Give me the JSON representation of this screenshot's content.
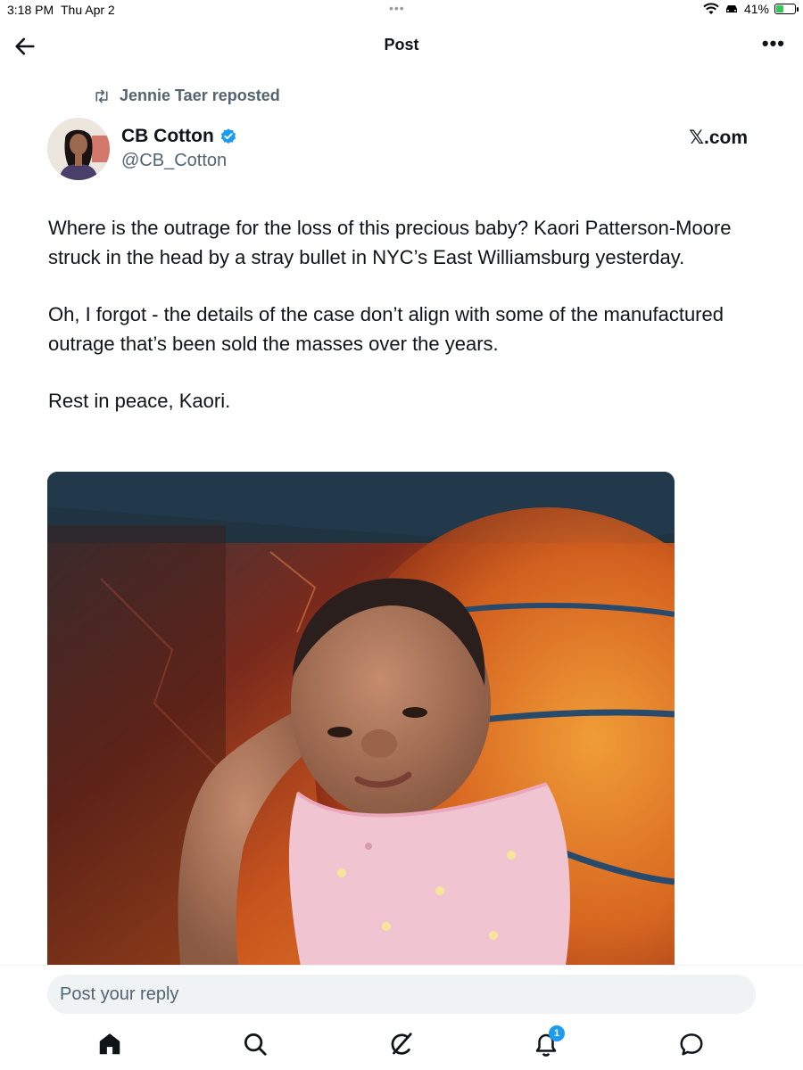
{
  "status_bar": {
    "time": "3:18 PM",
    "date": "Thu Apr 2",
    "battery": "41%",
    "battery_level": 0.41,
    "icons": [
      "wifi-icon",
      "car-icon",
      "battery-charging-icon"
    ]
  },
  "header": {
    "title": "Post",
    "back_icon": "arrow-left-icon",
    "more_icon": "more-horizontal-icon"
  },
  "repost": {
    "icon": "repost-icon",
    "label": "Jennie Taer reposted"
  },
  "author": {
    "name": "CB Cotton",
    "handle": "@CB_Cotton",
    "verified": true,
    "source": "𝕏.com"
  },
  "post": {
    "paragraphs": [
      "Where is the outrage for the loss of this precious baby? Kaori Patterson-Moore struck in the head by a stray bullet in NYC’s East Williamsburg yesterday.",
      "Oh, I forgot - the details of the case don’t align with some of the manufactured outrage that’s been sold the masses over the years.",
      "Rest in peace, Kaori."
    ]
  },
  "reply": {
    "placeholder": "Post your reply"
  },
  "tabbar": {
    "items": [
      {
        "icon": "home-icon"
      },
      {
        "icon": "search-icon"
      },
      {
        "icon": "grok-icon"
      },
      {
        "icon": "notifications-icon",
        "badge": "1"
      },
      {
        "icon": "messages-icon"
      }
    ]
  },
  "colors": {
    "text": "#0f1419",
    "secondary": "#536471",
    "accent": "#1d9bf0",
    "reply_bg": "#eff3f4"
  }
}
